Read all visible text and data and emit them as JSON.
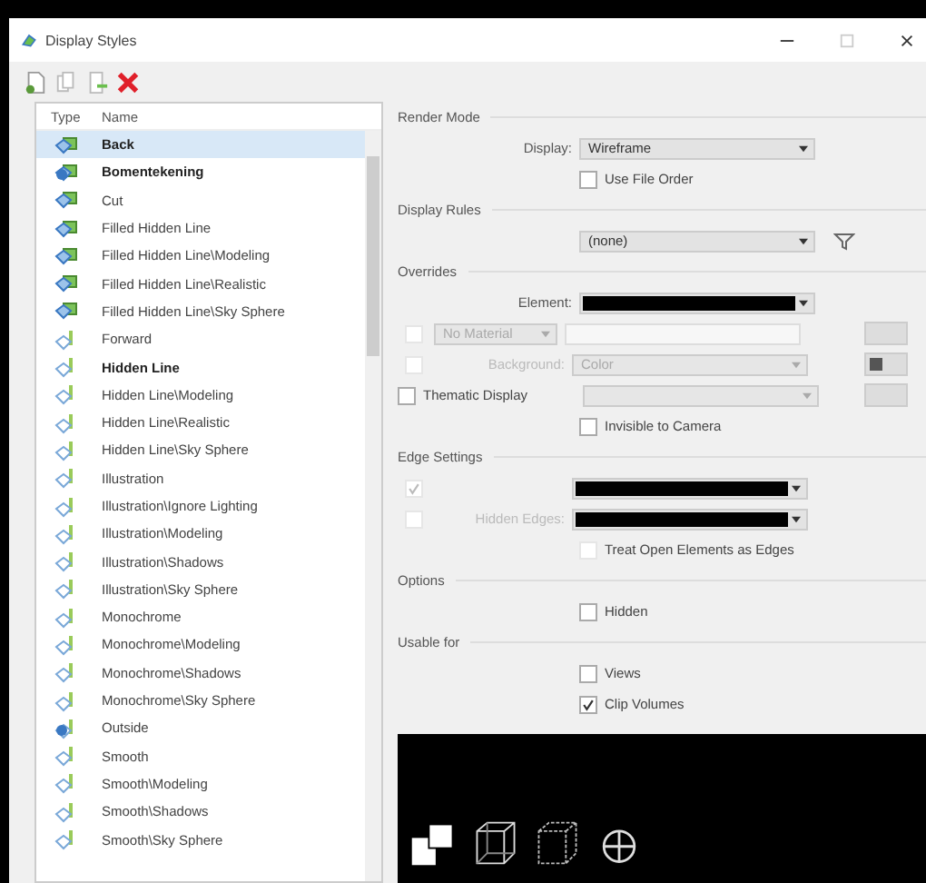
{
  "window": {
    "title": "Display Styles"
  },
  "list": {
    "columns": [
      "Type",
      "Name"
    ],
    "items": [
      {
        "name": "Back",
        "bold": true,
        "selected": true,
        "kind": "shaded"
      },
      {
        "name": "Bomentekening",
        "bold": true,
        "selected": false,
        "kind": "shadedpin"
      },
      {
        "name": "Cut",
        "bold": false,
        "selected": false,
        "kind": "shaded"
      },
      {
        "name": "Filled Hidden Line",
        "bold": false,
        "selected": false,
        "kind": "shaded"
      },
      {
        "name": "Filled Hidden Line\\Modeling",
        "bold": false,
        "selected": false,
        "kind": "shaded"
      },
      {
        "name": "Filled Hidden Line\\Realistic",
        "bold": false,
        "selected": false,
        "kind": "shaded"
      },
      {
        "name": "Filled Hidden Line\\Sky Sphere",
        "bold": false,
        "selected": false,
        "kind": "shaded"
      },
      {
        "name": "Forward",
        "bold": false,
        "selected": false,
        "kind": "wire"
      },
      {
        "name": "Hidden Line",
        "bold": true,
        "selected": false,
        "kind": "wire"
      },
      {
        "name": "Hidden Line\\Modeling",
        "bold": false,
        "selected": false,
        "kind": "wire"
      },
      {
        "name": "Hidden Line\\Realistic",
        "bold": false,
        "selected": false,
        "kind": "wire"
      },
      {
        "name": "Hidden Line\\Sky Sphere",
        "bold": false,
        "selected": false,
        "kind": "wire"
      },
      {
        "name": "Illustration",
        "bold": false,
        "selected": false,
        "kind": "wire"
      },
      {
        "name": "Illustration\\Ignore Lighting",
        "bold": false,
        "selected": false,
        "kind": "wire"
      },
      {
        "name": "Illustration\\Modeling",
        "bold": false,
        "selected": false,
        "kind": "wire"
      },
      {
        "name": "Illustration\\Shadows",
        "bold": false,
        "selected": false,
        "kind": "wire"
      },
      {
        "name": "Illustration\\Sky Sphere",
        "bold": false,
        "selected": false,
        "kind": "wire"
      },
      {
        "name": "Monochrome",
        "bold": false,
        "selected": false,
        "kind": "wire"
      },
      {
        "name": "Monochrome\\Modeling",
        "bold": false,
        "selected": false,
        "kind": "wire"
      },
      {
        "name": "Monochrome\\Shadows",
        "bold": false,
        "selected": false,
        "kind": "wire"
      },
      {
        "name": "Monochrome\\Sky Sphere",
        "bold": false,
        "selected": false,
        "kind": "wire"
      },
      {
        "name": "Outside",
        "bold": false,
        "selected": false,
        "kind": "wirepin"
      },
      {
        "name": "Smooth",
        "bold": false,
        "selected": false,
        "kind": "wire"
      },
      {
        "name": "Smooth\\Modeling",
        "bold": false,
        "selected": false,
        "kind": "wire"
      },
      {
        "name": "Smooth\\Shadows",
        "bold": false,
        "selected": false,
        "kind": "wire"
      },
      {
        "name": "Smooth\\Sky Sphere",
        "bold": false,
        "selected": false,
        "kind": "wire"
      }
    ]
  },
  "render_mode": {
    "heading": "Render Mode",
    "display_label": "Display:",
    "display_value": "Wireframe",
    "use_file_order": {
      "label": "Use File Order",
      "checked": false
    }
  },
  "display_rules": {
    "heading": "Display Rules",
    "value": "(none)"
  },
  "overrides": {
    "heading": "Overrides",
    "element_label": "Element:",
    "material": {
      "value": "No Material",
      "checked": false,
      "disabled": true
    },
    "background": {
      "label": "Background:",
      "value": "Color",
      "checked": false,
      "disabled": true
    },
    "thematic": {
      "label": "Thematic Display",
      "checked": false
    },
    "invisible_to_camera": {
      "label": "Invisible to Camera",
      "checked": false
    }
  },
  "edge_settings": {
    "heading": "Edge Settings",
    "visible_edges": {
      "checked": true,
      "disabled": true
    },
    "hidden_edges": {
      "label": "Hidden Edges:",
      "checked": false,
      "disabled": true
    },
    "treat_open": {
      "label": "Treat Open Elements as Edges",
      "checked": false,
      "disabled": true
    }
  },
  "options": {
    "heading": "Options",
    "hidden": {
      "label": "Hidden",
      "checked": false
    }
  },
  "usable_for": {
    "heading": "Usable for",
    "items": [
      {
        "label": "Views",
        "checked": false
      },
      {
        "label": "Clip Volumes",
        "checked": true
      }
    ]
  }
}
